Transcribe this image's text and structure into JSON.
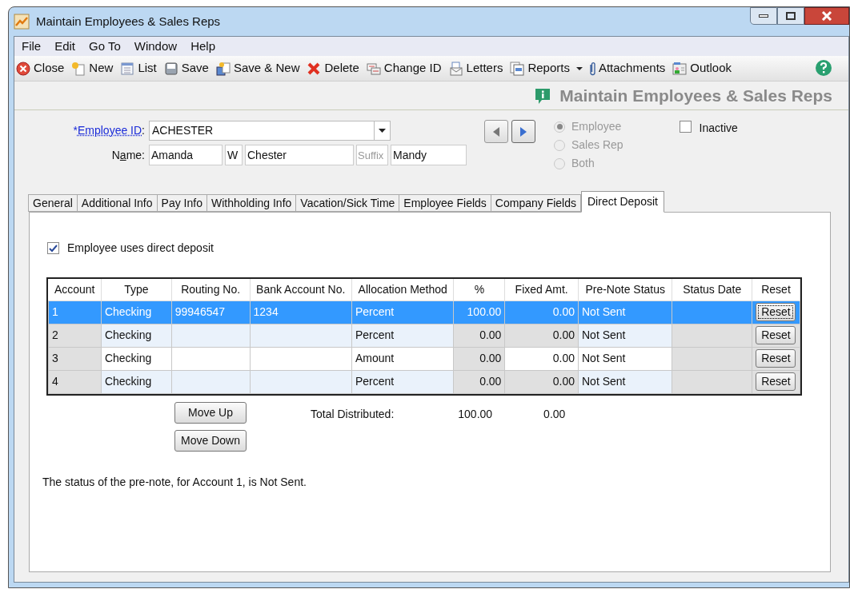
{
  "window": {
    "title": "Maintain Employees & Sales Reps"
  },
  "menu": [
    "File",
    "Edit",
    "Go To",
    "Window",
    "Help"
  ],
  "toolbar": [
    {
      "label": "Close",
      "dropdown": false
    },
    {
      "label": "New",
      "dropdown": false
    },
    {
      "label": "List",
      "dropdown": false
    },
    {
      "label": "Save",
      "dropdown": false
    },
    {
      "label": "Save & New",
      "dropdown": false
    },
    {
      "label": "Delete",
      "dropdown": false
    },
    {
      "label": "Change ID",
      "dropdown": false
    },
    {
      "label": "Letters",
      "dropdown": false
    },
    {
      "label": "Reports",
      "dropdown": true
    },
    {
      "label": "Attachments",
      "dropdown": false
    },
    {
      "label": "Outlook",
      "dropdown": false
    }
  ],
  "header": {
    "title": "Maintain Employees & Sales Reps"
  },
  "form": {
    "id_label_prefix": "*",
    "id_label": "Employee ID",
    "id_label_suffix": ":",
    "employee_id": "ACHESTER",
    "name_label_pre": "N",
    "name_label_ul": "a",
    "name_label_post": "me:",
    "first_name": "Amanda",
    "middle": "W",
    "last_name": "Chester",
    "suffix_placeholder": "Suffix",
    "nickname": "Mandy",
    "types": [
      {
        "label": "Employee",
        "selected": true
      },
      {
        "label": "Sales Rep",
        "selected": false
      },
      {
        "label": "Both",
        "selected": false
      }
    ],
    "inactive": {
      "label": "Inactive",
      "checked": false
    }
  },
  "tabs": [
    {
      "label": "General",
      "selected": false
    },
    {
      "label": "Additional Info",
      "selected": false
    },
    {
      "label": "Pay Info",
      "selected": false
    },
    {
      "label": "Withholding Info",
      "selected": false
    },
    {
      "label": "Vacation/Sick Time",
      "selected": false
    },
    {
      "label": "Employee Fields",
      "selected": false
    },
    {
      "label": "Company Fields",
      "selected": false
    },
    {
      "label": "Direct Deposit",
      "selected": true
    }
  ],
  "direct_deposit": {
    "label": "Employee uses direct deposit",
    "checked": true
  },
  "table": {
    "columns": [
      "Account",
      "Type",
      "Routing No.",
      "Bank Account No.",
      "Allocation Method",
      "%",
      "Fixed Amt.",
      "Pre-Note Status",
      "Status Date",
      "Reset"
    ],
    "rows": [
      {
        "selected": true,
        "cells": [
          "1",
          "Checking",
          "99946547",
          "1234",
          "Percent",
          "100.00",
          "0.00",
          "Not Sent"
        ],
        "button": "Reset"
      },
      {
        "selected": false,
        "fixed_editable": false,
        "cells": [
          "2",
          "Checking",
          "",
          "",
          "Percent",
          "0.00",
          "0.00",
          "Not Sent"
        ],
        "button": "Reset"
      },
      {
        "selected": false,
        "fixed_editable": true,
        "cells": [
          "3",
          "Checking",
          "",
          "",
          "Amount",
          "0.00",
          "0.00",
          "Not Sent"
        ],
        "button": "Reset"
      },
      {
        "selected": false,
        "fixed_editable": false,
        "cells": [
          "4",
          "Checking",
          "",
          "",
          "Percent",
          "0.00",
          "0.00",
          "Not Sent"
        ],
        "button": "Reset"
      }
    ]
  },
  "move_up": "Move Up",
  "move_down": "Move Down",
  "totals": {
    "label": "Total Distributed:",
    "percent": "100.00",
    "fixed": "0.00"
  },
  "status_message": "The status of the pre-note, for Account 1, is Not Sent."
}
